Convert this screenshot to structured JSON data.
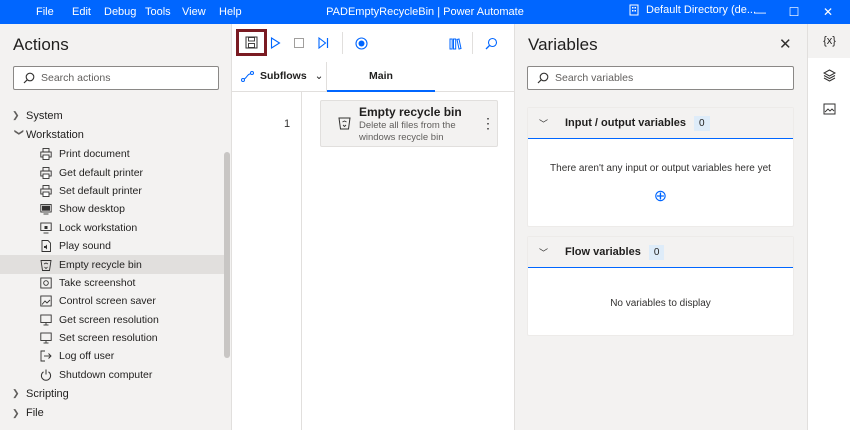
{
  "titlebar": {
    "menu": [
      "File",
      "Edit",
      "Debug",
      "Tools",
      "View",
      "Help"
    ],
    "title": "PADEmptyRecycleBin | Power Automate",
    "directory": "Default Directory (de...",
    "minimize": "—",
    "maximize": "☐",
    "close": "✕"
  },
  "actions": {
    "title": "Actions",
    "search_placeholder": "Search actions",
    "categories_top": [
      {
        "label": "System",
        "expanded": false
      }
    ],
    "workstation": {
      "label": "Workstation",
      "items": [
        {
          "label": "Print document",
          "icon": "printer-doc-icon"
        },
        {
          "label": "Get default printer",
          "icon": "printer-icon"
        },
        {
          "label": "Set default printer",
          "icon": "printer-icon"
        },
        {
          "label": "Show desktop",
          "icon": "desktop-icon"
        },
        {
          "label": "Lock workstation",
          "icon": "lock-icon"
        },
        {
          "label": "Play sound",
          "icon": "sound-file-icon"
        },
        {
          "label": "Empty recycle bin",
          "icon": "recycle-bin-icon",
          "selected": true
        },
        {
          "label": "Take screenshot",
          "icon": "screenshot-icon"
        },
        {
          "label": "Control screen saver",
          "icon": "screen-saver-icon"
        },
        {
          "label": "Get screen resolution",
          "icon": "monitor-icon"
        },
        {
          "label": "Set screen resolution",
          "icon": "monitor-icon"
        },
        {
          "label": "Log off user",
          "icon": "log-off-icon"
        },
        {
          "label": "Shutdown computer",
          "icon": "power-icon"
        }
      ]
    },
    "categories_bottom": [
      {
        "label": "Scripting"
      },
      {
        "label": "File"
      }
    ]
  },
  "designer": {
    "subflows_label": "Subflows",
    "main_tab": "Main",
    "steps": [
      {
        "number": "1",
        "title": "Empty recycle bin",
        "description": "Delete all files from the windows recycle bin"
      }
    ]
  },
  "variables": {
    "title": "Variables",
    "search_placeholder": "Search variables",
    "io_section": {
      "label": "Input / output variables",
      "count": "0",
      "message": "There aren't any input or output variables here yet"
    },
    "flow_section": {
      "label": "Flow variables",
      "count": "0",
      "message": "No variables to display"
    }
  },
  "rail": {
    "variables_label": "{x}"
  },
  "colors": {
    "accent": "#0066ff",
    "highlight_box": "#7a1b22"
  }
}
